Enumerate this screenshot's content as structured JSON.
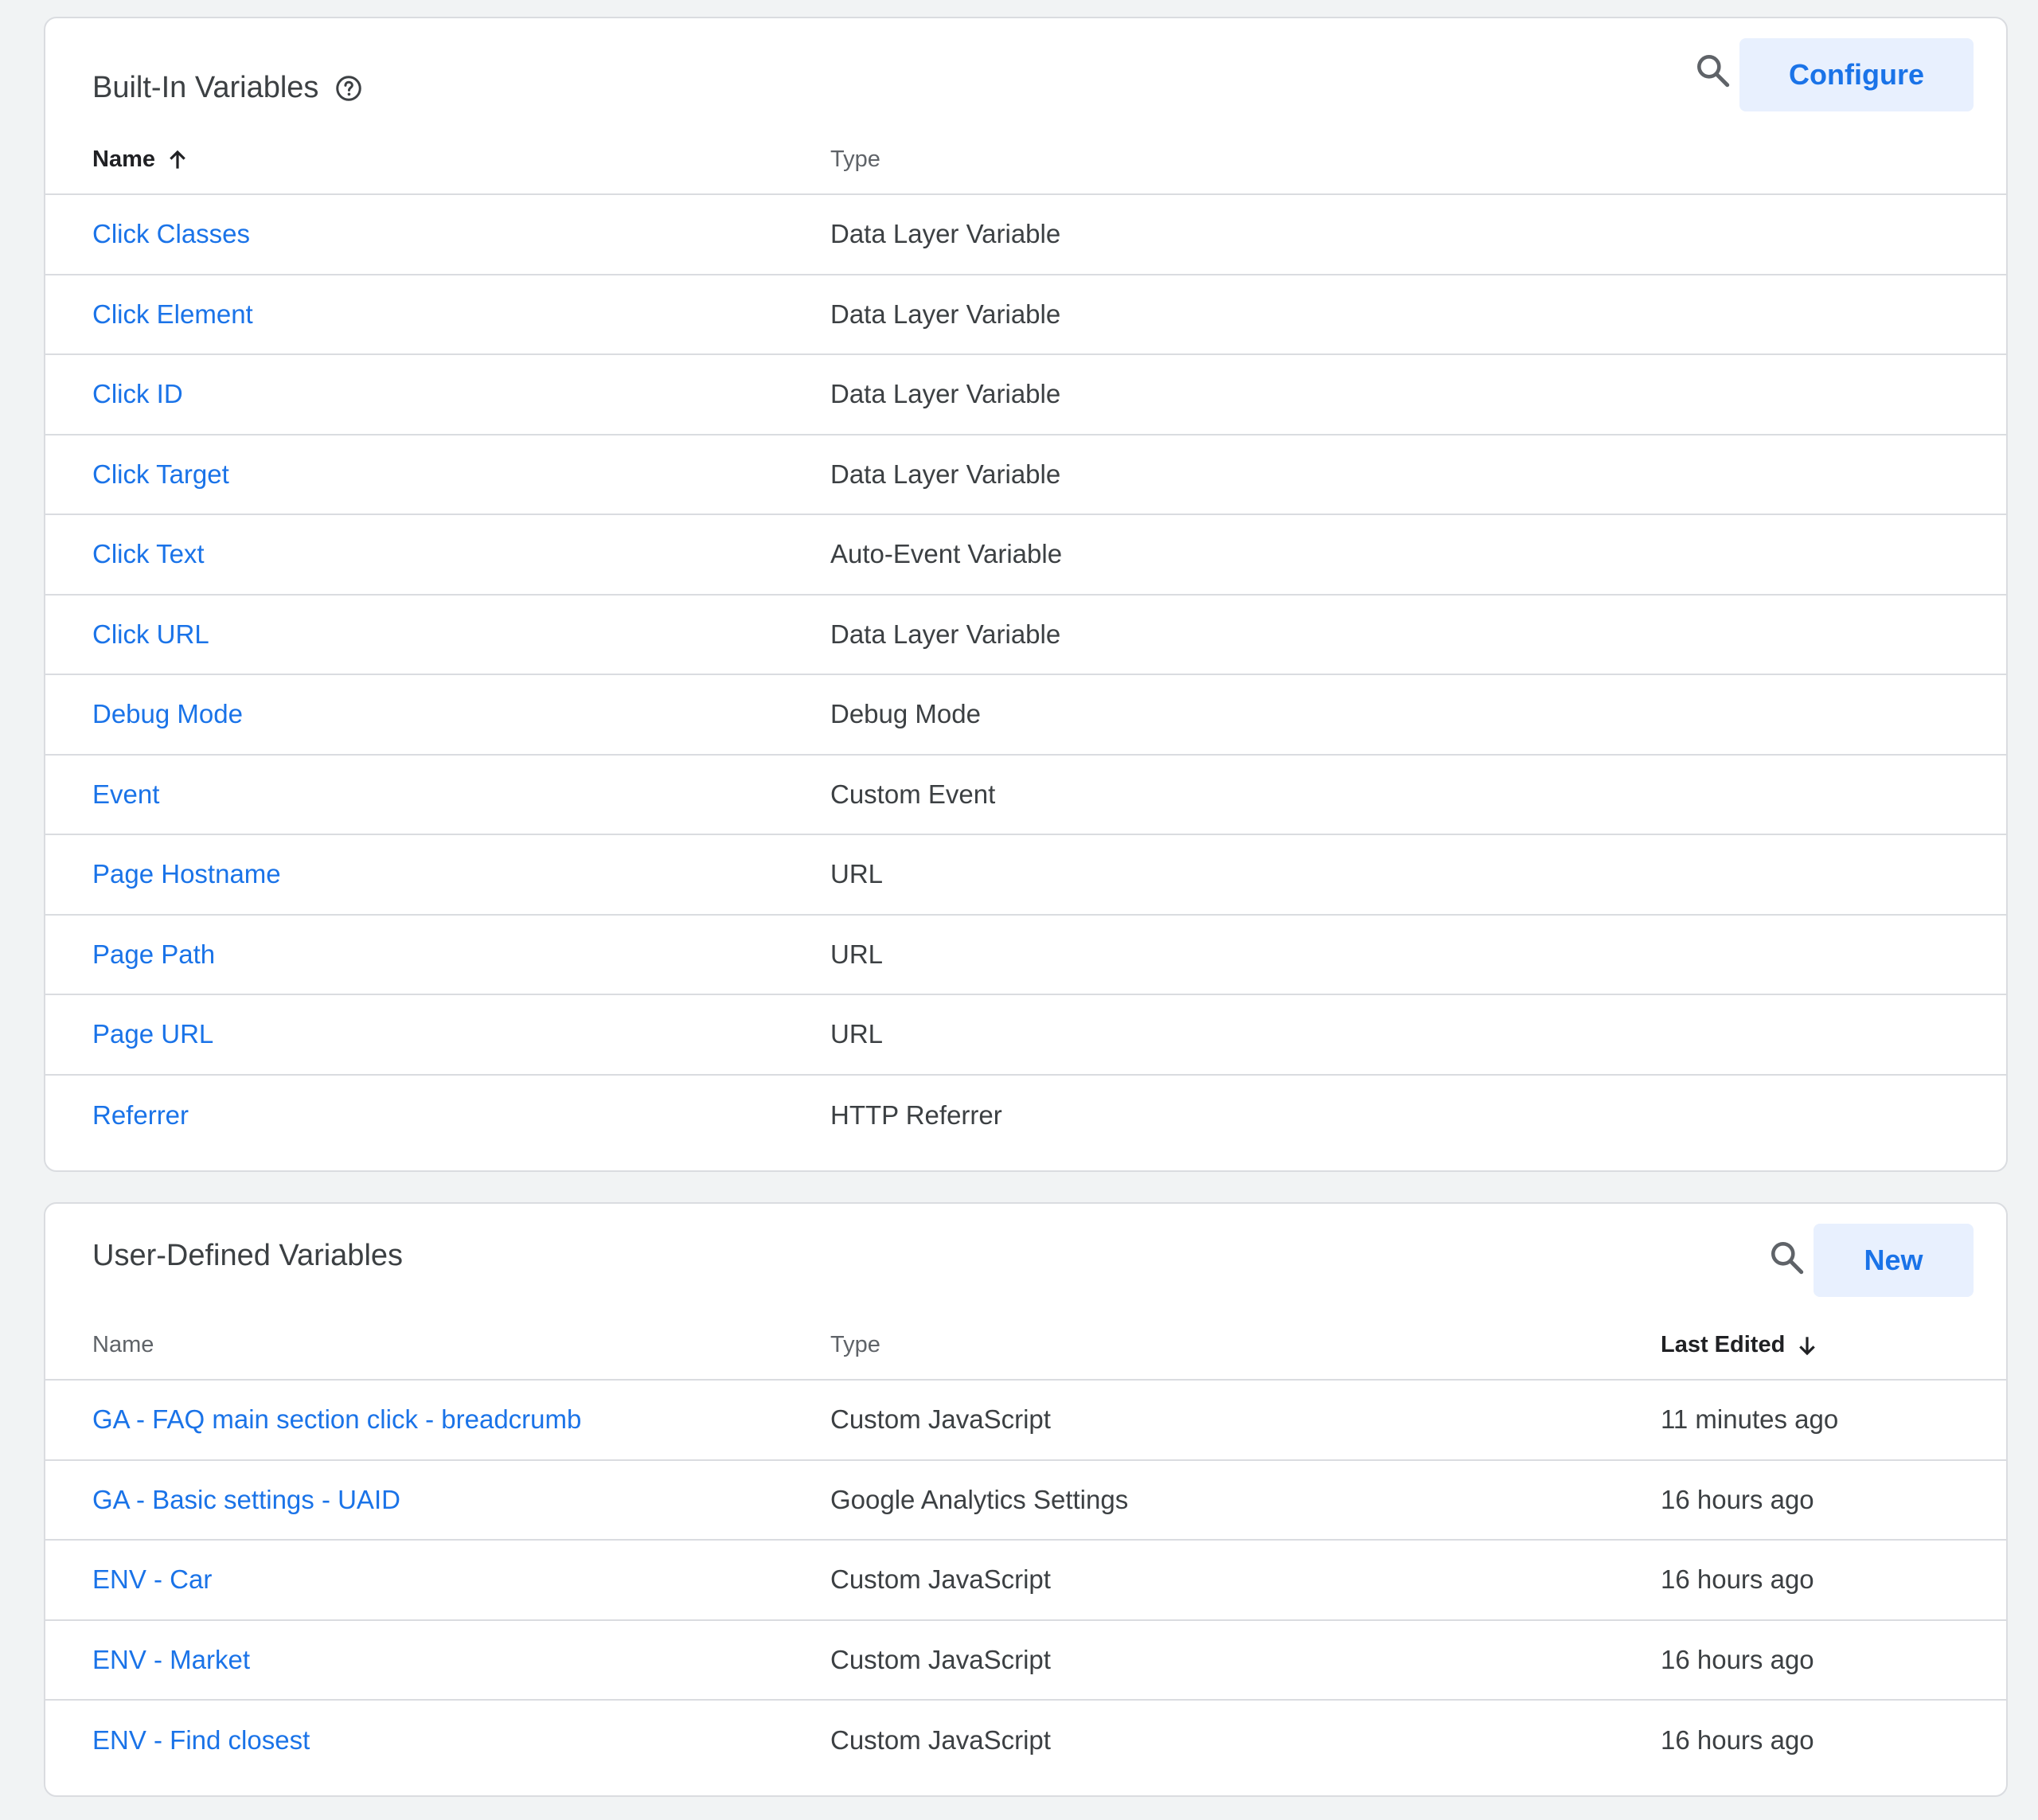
{
  "builtin": {
    "title": "Built-In Variables",
    "configure_label": "Configure",
    "columns": {
      "name": "Name",
      "type": "Type"
    },
    "rows": [
      {
        "name": "Click Classes",
        "type": "Data Layer Variable"
      },
      {
        "name": "Click Element",
        "type": "Data Layer Variable"
      },
      {
        "name": "Click ID",
        "type": "Data Layer Variable"
      },
      {
        "name": "Click Target",
        "type": "Data Layer Variable"
      },
      {
        "name": "Click Text",
        "type": "Auto-Event Variable"
      },
      {
        "name": "Click URL",
        "type": "Data Layer Variable"
      },
      {
        "name": "Debug Mode",
        "type": "Debug Mode"
      },
      {
        "name": "Event",
        "type": "Custom Event"
      },
      {
        "name": "Page Hostname",
        "type": "URL"
      },
      {
        "name": "Page Path",
        "type": "URL"
      },
      {
        "name": "Page URL",
        "type": "URL"
      },
      {
        "name": "Referrer",
        "type": "HTTP Referrer"
      }
    ]
  },
  "userdefined": {
    "title": "User-Defined Variables",
    "new_label": "New",
    "columns": {
      "name": "Name",
      "type": "Type",
      "last_edited": "Last Edited"
    },
    "rows": [
      {
        "name": "GA - FAQ main section click - breadcrumb",
        "type": "Custom JavaScript",
        "last_edited": "11 minutes ago"
      },
      {
        "name": "GA - Basic settings - UAID",
        "type": "Google Analytics Settings",
        "last_edited": "16 hours ago"
      },
      {
        "name": "ENV - Car",
        "type": "Custom JavaScript",
        "last_edited": "16 hours ago"
      },
      {
        "name": "ENV - Market",
        "type": "Custom JavaScript",
        "last_edited": "16 hours ago"
      },
      {
        "name": "ENV - Find closest",
        "type": "Custom JavaScript",
        "last_edited": "16 hours ago"
      }
    ]
  },
  "icons": [
    "help-icon",
    "search-icon",
    "arrow-up-icon",
    "arrow-down-icon"
  ],
  "colors": {
    "link": "#1a73e8",
    "button_bg": "#e8f0fe",
    "border": "#dadce0",
    "page_bg": "#f1f3f4"
  }
}
